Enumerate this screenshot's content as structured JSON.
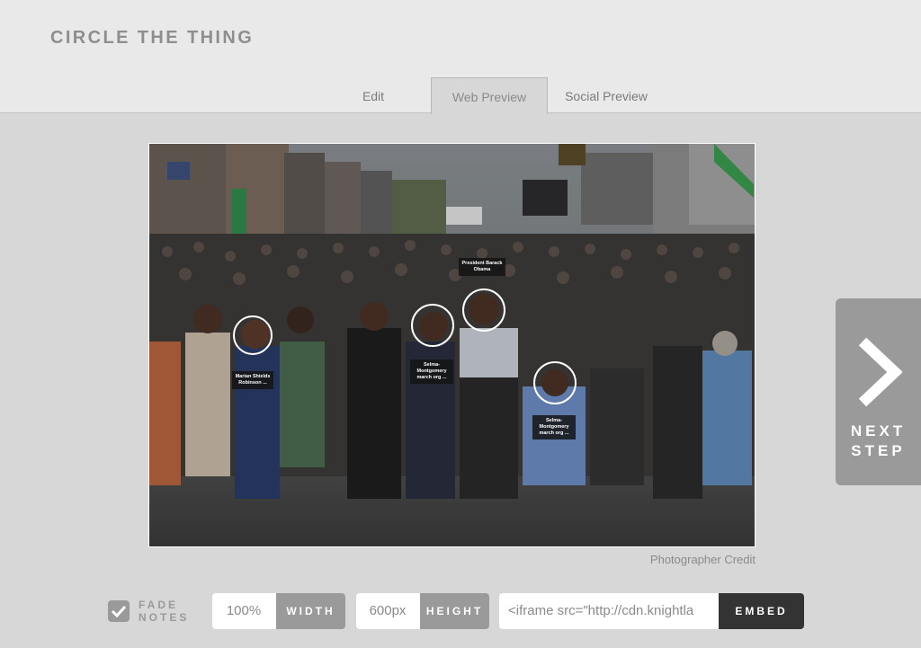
{
  "app": {
    "title": "CIRCLE THE THING"
  },
  "tabs": [
    {
      "label": "Edit",
      "active": false
    },
    {
      "label": "Web Preview",
      "active": true
    },
    {
      "label": "Social Preview",
      "active": false
    }
  ],
  "photo": {
    "description_icon": "photo-crowd-march",
    "credit": "Photographer Credit",
    "annotations": [
      {
        "label": "Marian Shields\nRobinson ..."
      },
      {
        "label": "Selma-\nMontgomery\nmarch org ..."
      },
      {
        "label": "President Barack\nObama"
      },
      {
        "label": "Selma-\nMontgomery\nmarch org ..."
      }
    ]
  },
  "next_step": {
    "label": "NEXT\nSTEP",
    "icon": "chevron-right-icon"
  },
  "controls": {
    "fade_notes": {
      "label": "FADE\nNOTES",
      "checked": true
    },
    "width": {
      "value": "100%",
      "button": "WIDTH"
    },
    "height": {
      "value": "600px",
      "button": "HEIGHT"
    },
    "embed": {
      "value": "<iframe src=\"http://cdn.knightla",
      "button": "EMBED"
    }
  },
  "colors": {
    "header_bg": "#e9e9e9",
    "body_bg": "#d7d7d7",
    "button_gray": "#9a9a9a",
    "embed_button": "#333333"
  }
}
